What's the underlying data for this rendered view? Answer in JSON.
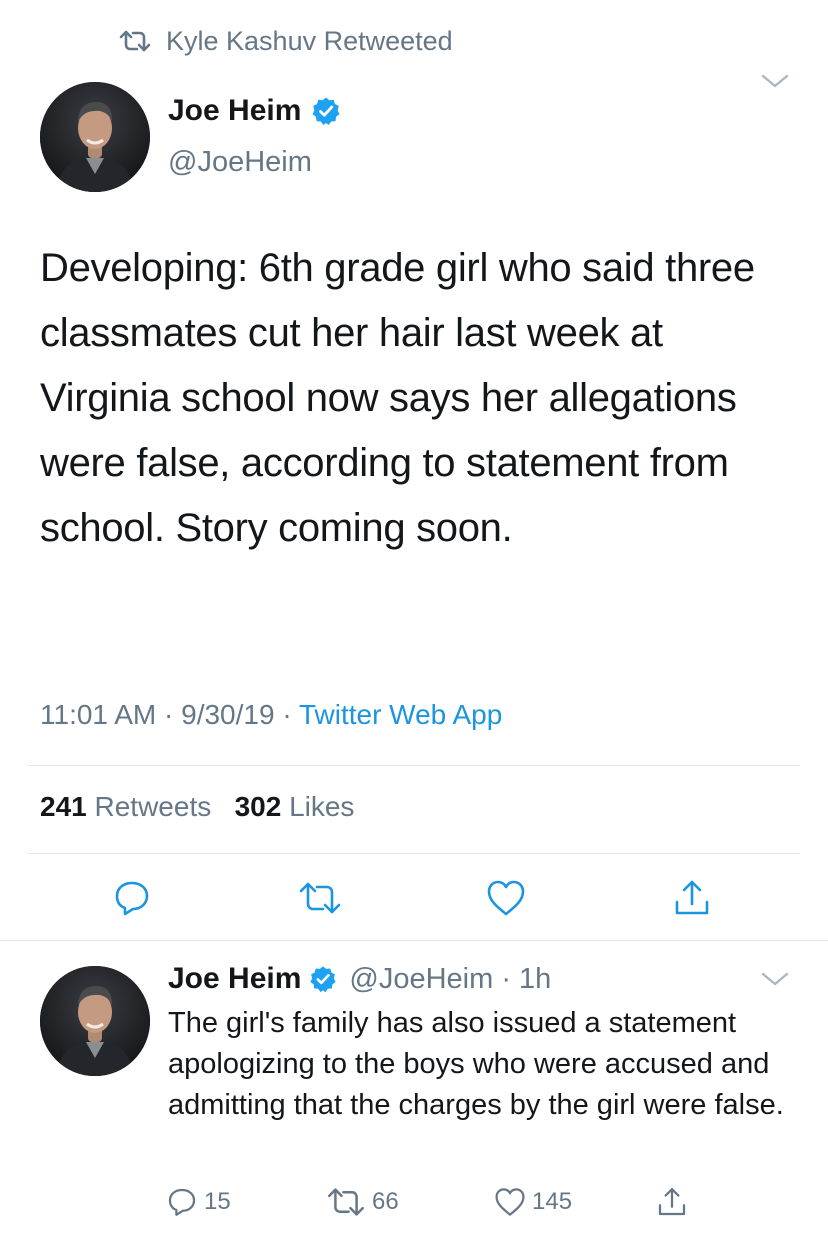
{
  "retweet_header": {
    "icon": "retweet-icon",
    "text": "Kyle Kashuv Retweeted"
  },
  "main_tweet": {
    "author_name": "Joe Heim",
    "verified_icon": "verified-badge-icon",
    "handle": "@JoeHeim",
    "text": "Developing: 6th grade girl who said three classmates cut her hair last week at Virginia school now says her allegations were false, according to statement from school. Story coming soon.",
    "time": "11:01 AM",
    "sep1": " · ",
    "date": "9/30/19",
    "sep2": " · ",
    "source": "Twitter Web App",
    "retweets_count": "241",
    "retweets_label": "Retweets",
    "likes_count": "302",
    "likes_label": "Likes",
    "actions": [
      "reply-icon",
      "retweet-icon",
      "like-icon",
      "share-icon"
    ]
  },
  "reply_tweet": {
    "author_name": "Joe Heim",
    "handle": "@JoeHeim",
    "time_sep": " · ",
    "time": "1h",
    "text": "The girl's family has also issued a statement apologizing to the boys who were accused and admitting that the charges by the girl were false.",
    "reply_count": "15",
    "retweet_count": "66",
    "like_count": "145"
  },
  "colors": {
    "text": "#14171a",
    "muted": "#657786",
    "link": "#1b95e0",
    "verified": "#1da1f2",
    "divider": "#e1e8ed"
  }
}
